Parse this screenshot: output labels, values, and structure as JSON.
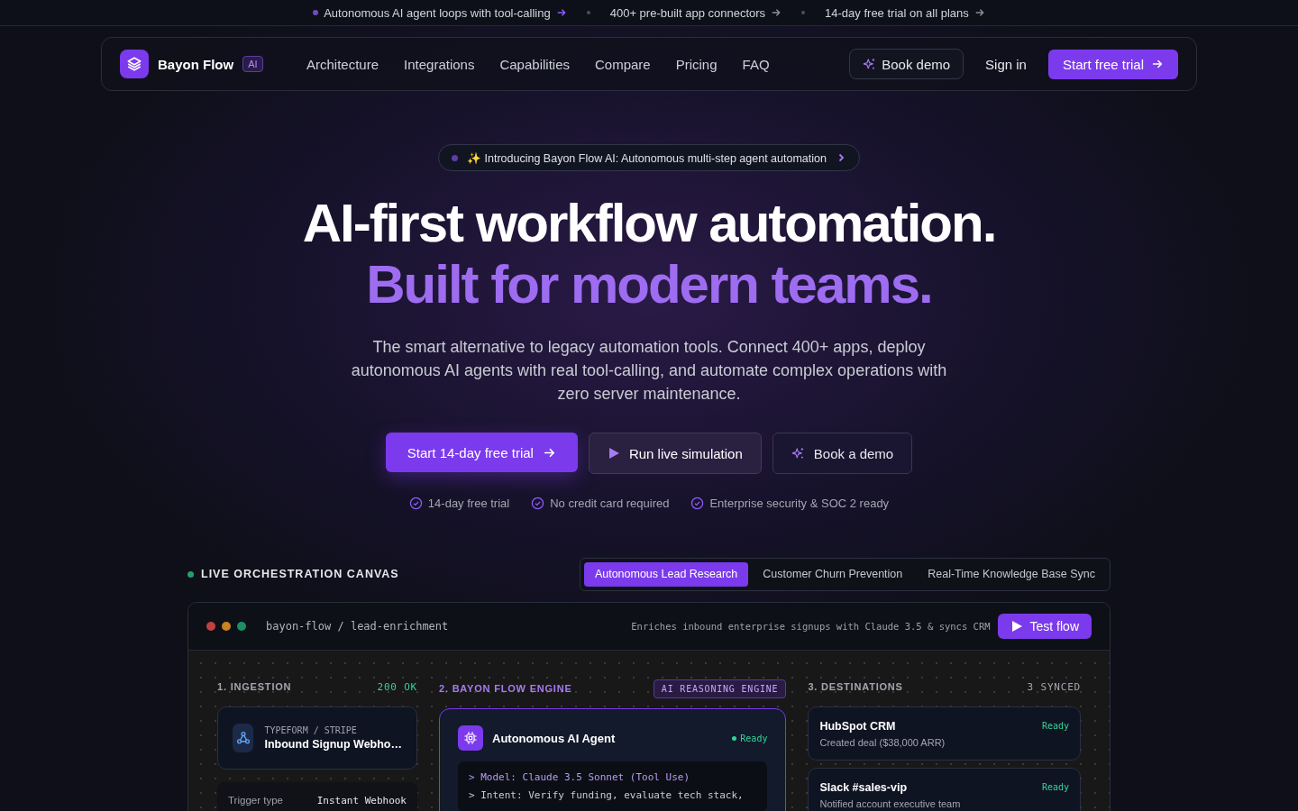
{
  "announcements": [
    {
      "text": "Autonomous AI agent loops with tool-calling",
      "highlighted": true
    },
    {
      "text": "400+ pre-built app connectors",
      "highlighted": false
    },
    {
      "text": "14-day free trial on all plans",
      "highlighted": false
    }
  ],
  "nav": {
    "brand": "Bayon Flow",
    "brand_badge": "AI",
    "links": [
      "Architecture",
      "Integrations",
      "Capabilities",
      "Compare",
      "Pricing",
      "FAQ"
    ],
    "book_demo": "Book demo",
    "sign_in": "Sign in",
    "cta": "Start free trial"
  },
  "hero": {
    "badge": "✨ Introducing Bayon Flow AI: Autonomous multi-step agent automation",
    "title_line_1": "AI-first workflow automation.",
    "title_line_2": "Built for modern teams.",
    "subtitle": "The smart alternative to legacy automation tools. Connect 400+ apps, deploy autonomous AI agents with real tool-calling, and automate complex operations with zero server maintenance.",
    "buttons": [
      {
        "kind": "primary",
        "label": "Start 14-day free trial"
      },
      {
        "kind": "play",
        "label": "Run live simulation"
      },
      {
        "kind": "sparkle",
        "label": "Book a demo"
      }
    ],
    "checks": [
      "14-day free trial",
      "No credit card required",
      "Enterprise security & SOC 2 ready"
    ]
  },
  "canvas": {
    "heading": "LIVE ORCHESTRATION CANVAS",
    "tabs": [
      {
        "label": "Autonomous Lead Research",
        "selected": true
      },
      {
        "label": "Customer Churn Prevention",
        "selected": false
      },
      {
        "label": "Real-Time Knowledge Base Sync",
        "selected": false
      }
    ],
    "window": {
      "path": "bayon-flow / lead-enrichment",
      "description": "Enriches inbound enterprise signups with Claude 3.5 & syncs CRM",
      "test_button": "Test flow"
    },
    "ingestion": {
      "title": "1. INGESTION",
      "status": "200 OK",
      "source": "TYPEFORM / STRIPE",
      "name": "Inbound Signup Webho…",
      "detail_label": "Trigger type",
      "detail_value": "Instant Webhook"
    },
    "engine": {
      "title": "2. BAYON FLOW ENGINE",
      "tag": "AI REASONING ENGINE",
      "agent": "Autonomous AI Agent",
      "status": "Ready",
      "lines": [
        "> Model: Claude 3.5 Sonnet (Tool Use)",
        "> Intent: Verify funding, evaluate tech stack,"
      ]
    },
    "destinations": {
      "title": "3. DESTINATIONS",
      "count": "3 SYNCED",
      "items": [
        {
          "name": "HubSpot CRM",
          "status": "Ready",
          "detail": "Created deal ($38,000 ARR)"
        },
        {
          "name": "Slack #sales-vip",
          "status": "Ready",
          "detail": "Notified account executive team"
        }
      ]
    }
  }
}
